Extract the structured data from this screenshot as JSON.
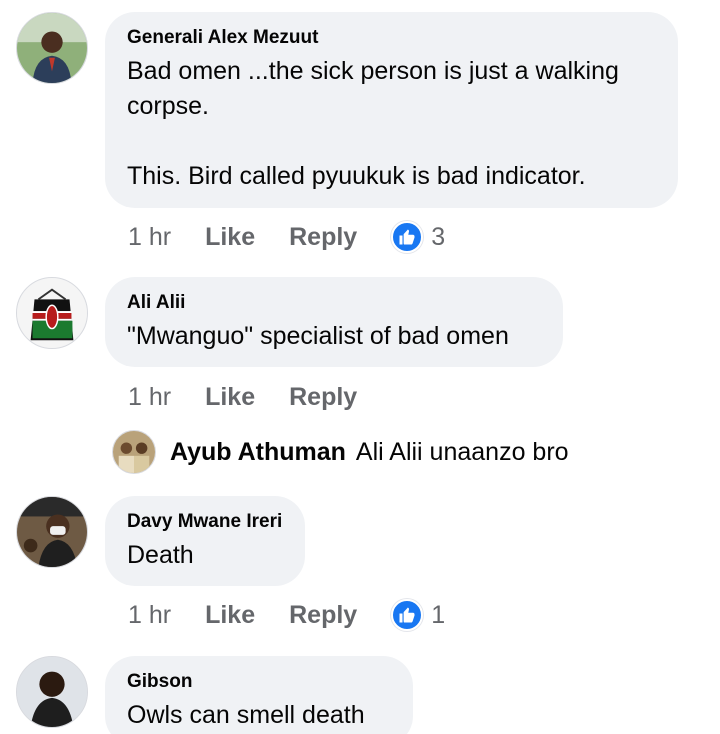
{
  "comments": [
    {
      "author": "Generali Alex Mezuut",
      "text": "Bad omen ...the sick person is just a walking\ncorpse.\n\nThis. Bird called pyuukuk is bad indicator.",
      "time": "1 hr",
      "like": "Like",
      "reply": "Reply",
      "reactions": "3",
      "avatar_icon": "person-outdoor-avatar"
    },
    {
      "author": "Ali Alii",
      "text": "\"Mwanguo\" specialist of bad omen",
      "time": "1 hr",
      "like": "Like",
      "reply": "Reply",
      "avatar_icon": "kenya-flag-bag-avatar"
    },
    {
      "author": "Davy Mwane Ireri",
      "text": "Death",
      "time": "1 hr",
      "like": "Like",
      "reply": "Reply",
      "reactions": "1",
      "avatar_icon": "person-with-mask-avatar"
    },
    {
      "author": "Gibson",
      "text": "Owls can smell death",
      "avatar_icon": "person-avatar"
    }
  ],
  "reply_preview": {
    "author": "Ayub Athuman",
    "text": "Ali Alii unaanzo bro",
    "avatar_icon": "group-photo-avatar"
  },
  "colors": {
    "bubble": "#f0f2f5",
    "meta_text": "#65676b",
    "like_blue": "#1877f2"
  }
}
